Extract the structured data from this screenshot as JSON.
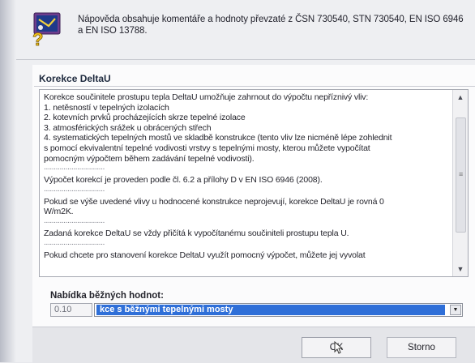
{
  "header": {
    "info_text": "Nápověda obsahuje komentáře a hodnoty převzaté z ČSN 730540, STN 730540, EN ISO 6946 a EN ISO 13788.",
    "icon": "help-book-icon"
  },
  "panel": {
    "title": "Korekce DeltaU",
    "memo": {
      "lines": [
        "Korekce součinitele prostupu tepla DeltaU umožňuje zahrnout do výpočtu nepříznivý vliv:",
        "1. netěsností v tepelných izolacích",
        "2. kotevních prvků procházejících skrze tepelné izolace",
        "3. atmosférických srážek u obrácených střech",
        "4. systematických tepelných mostů ve skladbě konstrukce (tento vliv lze nicméně lépe zohlednit",
        "s pomocí ekvivalentní tepelné vodivosti vrstvy s tepelnými mosty, kterou můžete vypočítat",
        "pomocným výpočtem během zadávání tepelné vodivosti).",
        "Výpočet korekcí je proveden podle čl. 6.2 a přílohy D v EN ISO 6946 (2008).",
        "Pokud se výše uvedené vlivy u hodnocené konstrukce neprojevují, korekce DeltaU je rovná 0",
        "W/m2K.",
        "Zadaná korekce DeltaU se vždy přičítá k vypočítanému součiniteli prostupu tepla U.",
        "Pokud chcete pro stanovení korekce DeltaU využít pomocný výpočet, můžete jej vyvolat"
      ],
      "separator": "..............................."
    }
  },
  "offers": {
    "label": "Nabídka běžných hodnot:",
    "value": "0.10",
    "selected_option": "kce s běžnými tepelnými mosty"
  },
  "buttons": {
    "ok": "OK",
    "cancel": "Storno"
  },
  "colors": {
    "selection": "#2f6fd8",
    "panel_bg": "#fbfbfc"
  }
}
